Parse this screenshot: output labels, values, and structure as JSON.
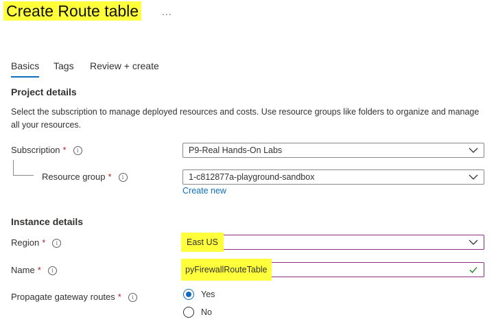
{
  "page": {
    "title": "Create Route table",
    "more": "..."
  },
  "tabs": [
    {
      "label": "Basics",
      "active": true
    },
    {
      "label": "Tags",
      "active": false
    },
    {
      "label": "Review + create",
      "active": false
    }
  ],
  "project": {
    "heading": "Project details",
    "description": "Select the subscription to manage deployed resources and costs. Use resource groups like folders to organize and manage all your resources.",
    "subscription": {
      "label": "Subscription",
      "value": "P9-Real Hands-On Labs"
    },
    "resource_group": {
      "label": "Resource group",
      "value": "1-c812877a-playground-sandbox",
      "create_new": "Create new"
    }
  },
  "instance": {
    "heading": "Instance details",
    "region": {
      "label": "Region",
      "value": "East US"
    },
    "name": {
      "label": "Name",
      "value": "pyFirewallRouteTable"
    },
    "propagate": {
      "label": "Propagate gateway routes",
      "options": [
        {
          "label": "Yes",
          "selected": true
        },
        {
          "label": "No",
          "selected": false
        }
      ]
    }
  },
  "markers": {
    "required": "*",
    "info": "i"
  },
  "colors": {
    "accent": "#0f6cbd",
    "required": "#a4262c",
    "highlight": "#ffff3b",
    "focus_border": "#8d2d7c",
    "valid_check": "#107c10"
  },
  "icons": {
    "dropdown": "chevron-down-icon",
    "info": "info-icon",
    "valid": "checkmark-icon"
  }
}
